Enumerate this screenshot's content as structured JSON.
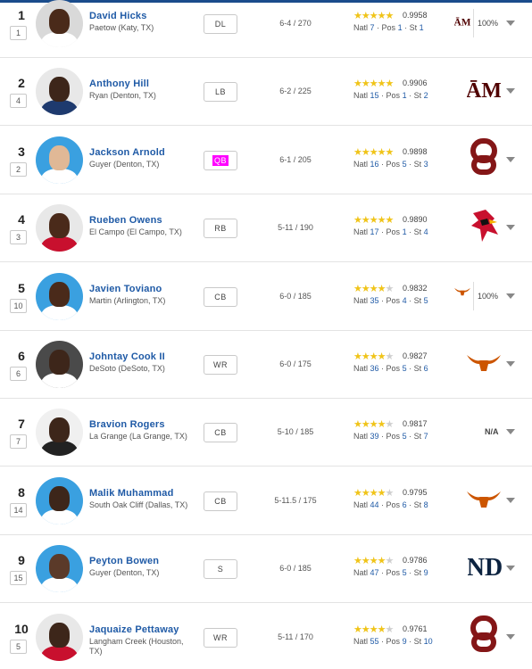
{
  "colors": {
    "link": "#1f5aa6",
    "star": "#f0c419",
    "tamu": "#500000",
    "ou": "#841617",
    "texas": "#cc5500",
    "louisville": "#c8102e",
    "notre_dame": "#0c2340",
    "qb_highlight": "#ff00ff"
  },
  "players": [
    {
      "rank": "1",
      "prev_rank": "1",
      "name": "David Hicks",
      "school": "Paetow (Katy, TX)",
      "position": "DL",
      "height_weight": "6-4 / 270",
      "stars": 5,
      "rating": "0.9958",
      "natl": "7",
      "pos_rank": "1",
      "state_rank": "1",
      "logo": "texas-am-logo",
      "logo_text": "ĀM",
      "percent": "100%",
      "na": ""
    },
    {
      "rank": "2",
      "prev_rank": "4",
      "name": "Anthony Hill",
      "school": "Ryan (Denton, TX)",
      "position": "LB",
      "height_weight": "6-2 / 225",
      "stars": 5,
      "rating": "0.9906",
      "natl": "15",
      "pos_rank": "1",
      "state_rank": "2",
      "logo": "texas-am-logo",
      "logo_text": "ĀM",
      "percent": "",
      "na": ""
    },
    {
      "rank": "3",
      "prev_rank": "2",
      "name": "Jackson Arnold",
      "school": "Guyer (Denton, TX)",
      "position": "QB",
      "height_weight": "6-1 / 205",
      "stars": 5,
      "rating": "0.9898",
      "natl": "16",
      "pos_rank": "5",
      "state_rank": "3",
      "logo": "oklahoma-logo",
      "logo_text": "OU",
      "percent": "",
      "na": ""
    },
    {
      "rank": "4",
      "prev_rank": "3",
      "name": "Rueben Owens",
      "school": "El Campo (El Campo, TX)",
      "position": "RB",
      "height_weight": "5-11 / 190",
      "stars": 5,
      "rating": "0.9890",
      "natl": "17",
      "pos_rank": "1",
      "state_rank": "4",
      "logo": "louisville-logo",
      "logo_text": "",
      "percent": "",
      "na": ""
    },
    {
      "rank": "5",
      "prev_rank": "10",
      "name": "Javien Toviano",
      "school": "Martin (Arlington, TX)",
      "position": "CB",
      "height_weight": "6-0 / 185",
      "stars": 4,
      "rating": "0.9832",
      "natl": "35",
      "pos_rank": "4",
      "state_rank": "5",
      "logo": "texas-longhorn-logo",
      "logo_text": "",
      "percent": "100%",
      "na": ""
    },
    {
      "rank": "6",
      "prev_rank": "6",
      "name": "Johntay Cook II",
      "school": "DeSoto (DeSoto, TX)",
      "position": "WR",
      "height_weight": "6-0 / 175",
      "stars": 4,
      "rating": "0.9827",
      "natl": "36",
      "pos_rank": "5",
      "state_rank": "6",
      "logo": "texas-longhorn-logo",
      "logo_text": "",
      "percent": "",
      "na": ""
    },
    {
      "rank": "7",
      "prev_rank": "7",
      "name": "Bravion Rogers",
      "school": "La Grange (La Grange, TX)",
      "position": "CB",
      "height_weight": "5-10 / 185",
      "stars": 4,
      "rating": "0.9817",
      "natl": "39",
      "pos_rank": "5",
      "state_rank": "7",
      "logo": "",
      "logo_text": "",
      "percent": "",
      "na": "N/A"
    },
    {
      "rank": "8",
      "prev_rank": "14",
      "name": "Malik Muhammad",
      "school": "South Oak Cliff (Dallas, TX)",
      "position": "CB",
      "height_weight": "5-11.5 / 175",
      "stars": 4,
      "rating": "0.9795",
      "natl": "44",
      "pos_rank": "6",
      "state_rank": "8",
      "logo": "texas-longhorn-logo",
      "logo_text": "",
      "percent": "",
      "na": ""
    },
    {
      "rank": "9",
      "prev_rank": "15",
      "name": "Peyton Bowen",
      "school": "Guyer (Denton, TX)",
      "position": "S",
      "height_weight": "6-0 / 185",
      "stars": 4,
      "rating": "0.9786",
      "natl": "47",
      "pos_rank": "5",
      "state_rank": "9",
      "logo": "notre-dame-logo",
      "logo_text": "ND",
      "percent": "",
      "na": ""
    },
    {
      "rank": "10",
      "prev_rank": "5",
      "name": "Jaquaize Pettaway",
      "school": "Langham Creek (Houston, TX)",
      "position": "WR",
      "height_weight": "5-11 / 170",
      "stars": 4,
      "rating": "0.9761",
      "natl": "55",
      "pos_rank": "9",
      "state_rank": "10",
      "logo": "oklahoma-logo",
      "logo_text": "OU",
      "percent": "",
      "na": ""
    }
  ],
  "labels": {
    "natl": "Natl",
    "pos": "Pos",
    "st": "St"
  }
}
